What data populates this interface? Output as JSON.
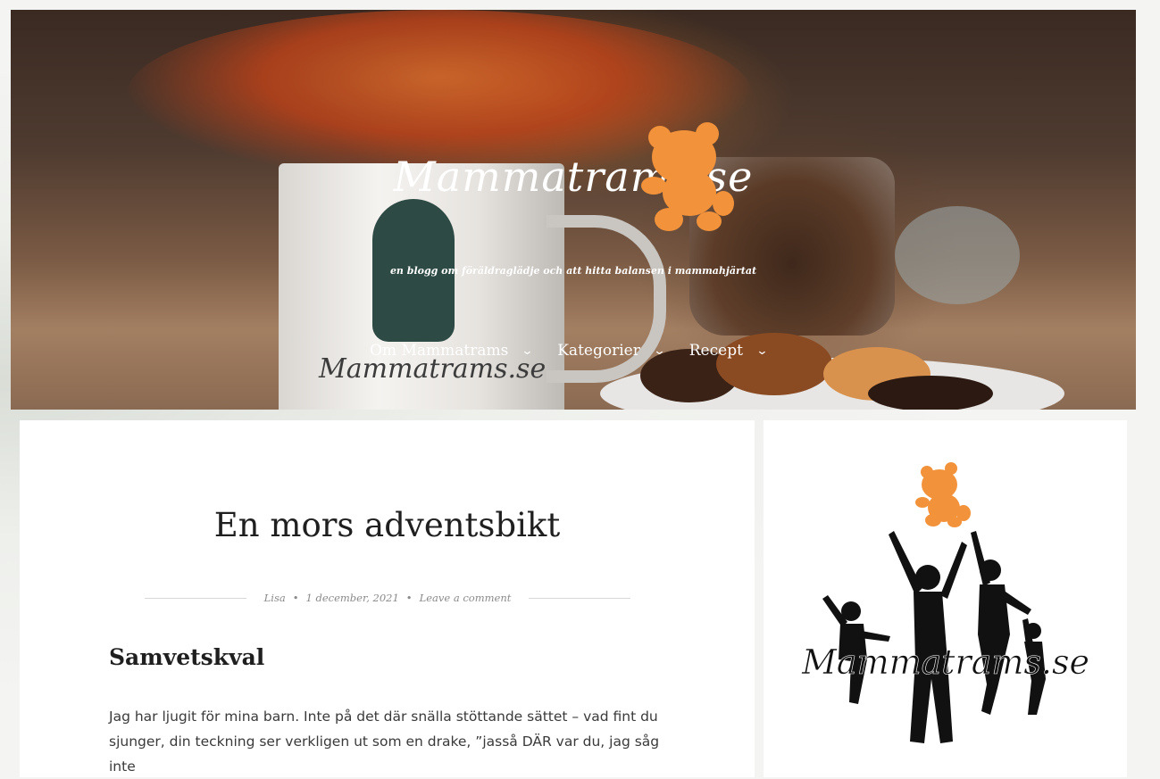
{
  "header": {
    "site_title": "Mammatrams.se",
    "tagline": "en blogg om föräldraglädje och att hitta balansen i mammahjärtat",
    "mug_text": "Mammatrams.se",
    "nav": [
      {
        "label": "Om Mammatrams",
        "icon": "chevron-down-icon"
      },
      {
        "label": "Kategorier",
        "icon": "chevron-down-icon"
      },
      {
        "label": "Recept",
        "icon": "chevron-down-icon"
      }
    ]
  },
  "post": {
    "title": "En mors adventsbikt",
    "author": "Lisa",
    "separator": "•",
    "date": "1 december, 2021",
    "comment_link": "Leave a comment",
    "heading": "Samvetskval",
    "paragraph": "Jag har ljugit för mina barn. Inte på det där snälla stöttande sättet – vad fint du sjunger, din teckning ser verkligen ut som en drake, ”jasså DÄR var du, jag såg inte"
  },
  "sidebar": {
    "logo_text": "Mammatrams.se"
  },
  "colors": {
    "accent_orange": "#f2923a",
    "text_dark": "#1f1f1f",
    "meta_gray": "#8a8a8a"
  }
}
